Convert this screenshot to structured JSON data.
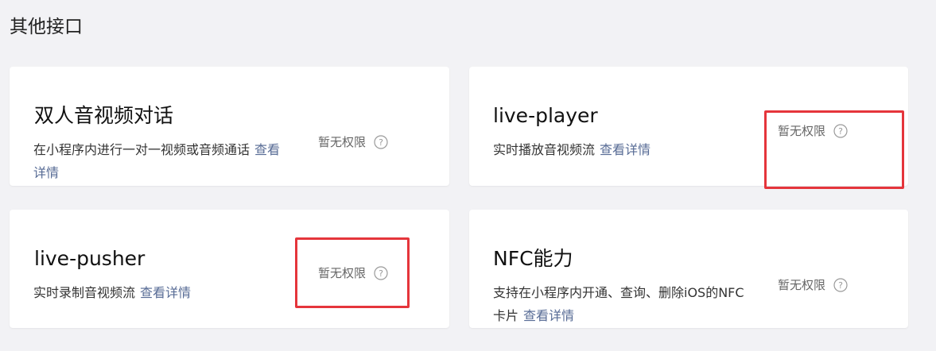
{
  "section": {
    "title": "其他接口"
  },
  "cards": [
    {
      "title": "双人音视频对话",
      "desc_line1": "在小程序内进行一对一视频或音频通话",
      "link_line1": "查看",
      "link_line2": "详情",
      "status": "暂无权限"
    },
    {
      "title": "live-player",
      "desc": "实时播放音视频流",
      "link": "查看详情",
      "status": "暂无权限"
    },
    {
      "title": "live-pusher",
      "desc": "实时录制音视频流",
      "link": "查看详情",
      "status": "暂无权限"
    },
    {
      "title": "NFC能力",
      "desc_line1": "支持在小程序内开通、查询、删除iOS的NFC",
      "desc_line2": "卡片",
      "link": "查看详情",
      "status": "暂无权限"
    }
  ],
  "colors": {
    "link": "#576b95",
    "highlight": "#e5353b",
    "background": "#f2f2f5"
  },
  "icons": {
    "help": "question-circle-icon"
  }
}
